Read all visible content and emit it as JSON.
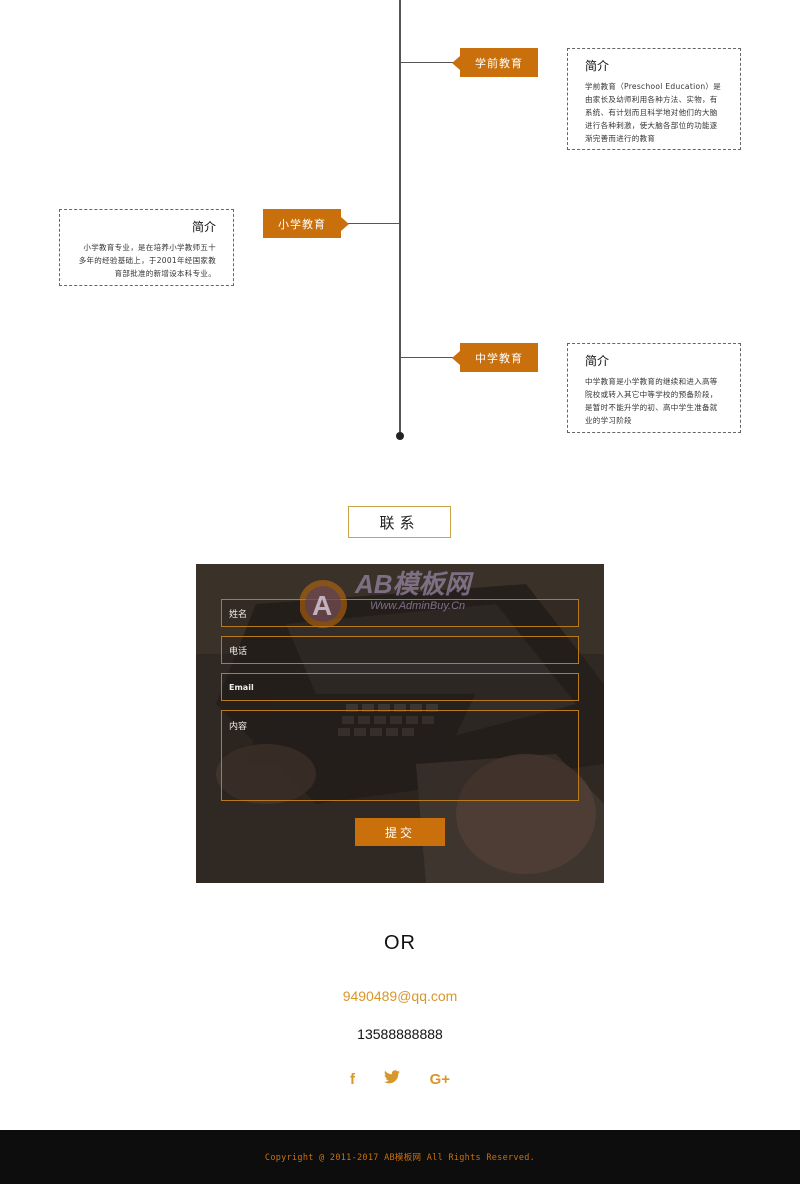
{
  "timeline": {
    "items": [
      {
        "tag": "学前教育",
        "intro_title": "简介",
        "intro_text": "学前教育（Preschool Education）是由家长及幼师利用各种方法、实物，有系统、有计划而且科学地对他们的大脑进行各种刺激，使大脑各部位的功能逐渐完善而进行的教育"
      },
      {
        "tag": "小学教育",
        "intro_title": "简介",
        "intro_text": "小学教育专业，是在培养小学教师五十多年的经验基础上，于2001年经国家教育部批准的新增设本科专业。"
      },
      {
        "tag": "中学教育",
        "intro_title": "简介",
        "intro_text": "中学教育是小学教育的继续和进入高等院校或转入其它中等学校的预备阶段，是暂时不能升学的初、高中学生准备就业的学习阶段"
      }
    ]
  },
  "contact": {
    "title": "联系",
    "form": {
      "name_placeholder": "姓名",
      "phone_placeholder": "电话",
      "email_placeholder": "Email",
      "content_placeholder": "内容",
      "submit_label": "提交"
    },
    "watermark": {
      "brand": "AB模板网",
      "url": "Www.AdminBuy.Cn"
    }
  },
  "or_text": "OR",
  "email": "9490489@qq.com",
  "phone": "13588888888",
  "social": [
    {
      "icon": "facebook-icon",
      "glyph": "f"
    },
    {
      "icon": "twitter-icon",
      "glyph": "🐦"
    },
    {
      "icon": "google-plus-icon",
      "glyph": "G+"
    }
  ],
  "footer": {
    "copyright": "Copyright @ 2011-2017 AB模板网 All Rights Reserved."
  },
  "colors": {
    "accent": "#c9700c",
    "link": "#d8972b",
    "footer_bg": "#0d0d0d"
  }
}
